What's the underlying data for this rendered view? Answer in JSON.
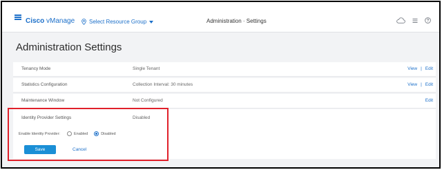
{
  "header": {
    "brand_bold": "Cisco",
    "brand_light": "vManage",
    "resource_group": "Select Resource Group",
    "page_center_title": "Administration · Settings",
    "icons": [
      "menu-icon",
      "location-icon",
      "caret-down-icon",
      "cloud-icon",
      "list-icon",
      "help-icon"
    ]
  },
  "page": {
    "title": "Administration Settings"
  },
  "rows": [
    {
      "label": "Tenancy Mode",
      "value": "Single Tenant",
      "view": "View",
      "sep": "|",
      "edit": "Edit"
    },
    {
      "label": "Statistics Configuration",
      "value": "Collection Interval: 30 minutes",
      "view": "View",
      "sep": "|",
      "edit": "Edit"
    },
    {
      "label": "Maintenance Window",
      "value": "Not Configured",
      "edit": "Edit"
    }
  ],
  "identity_provider": {
    "label": "Identity Provider Settings",
    "value": "Disabled",
    "enable_label": "Enable Identity Provider:",
    "options": [
      {
        "label": "Enabled",
        "selected": false
      },
      {
        "label": "Disabled",
        "selected": true
      }
    ],
    "save_label": "Save",
    "cancel_label": "Cancel"
  },
  "colors": {
    "accent": "#1b6fc9",
    "save_button": "#1a8fd6",
    "highlight": "#e0202a",
    "background": "#f2f3f5"
  }
}
